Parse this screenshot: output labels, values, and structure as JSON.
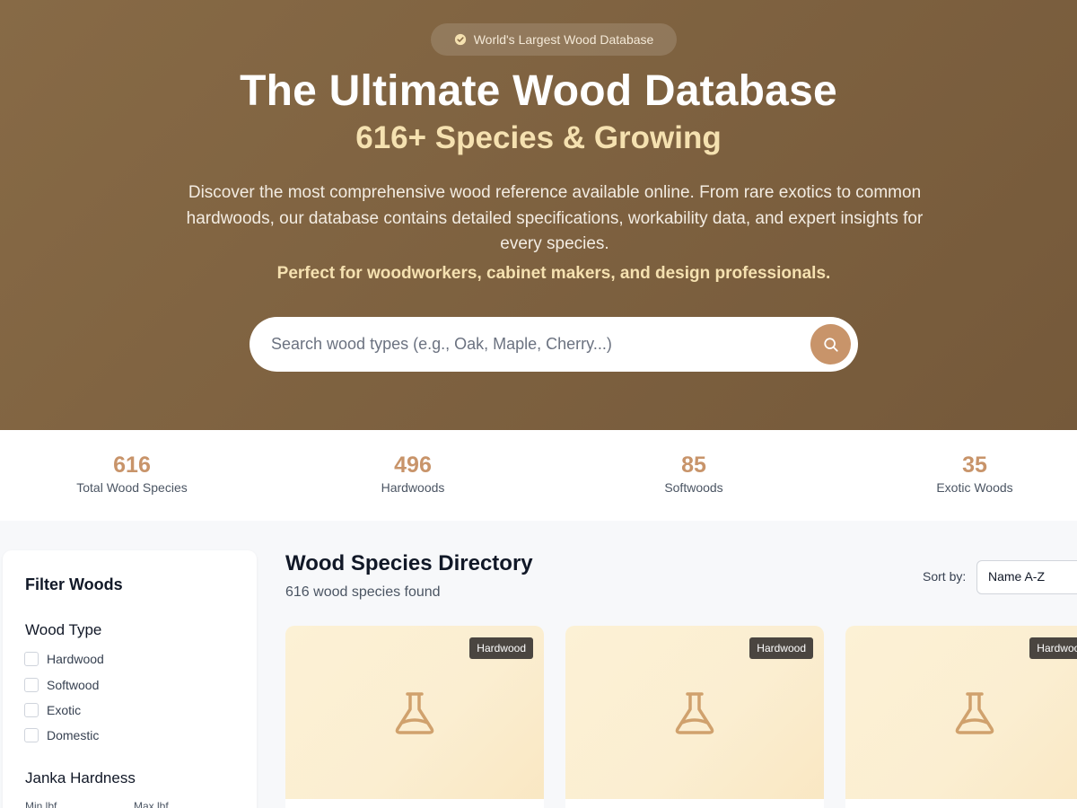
{
  "hero": {
    "badge": "World's Largest Wood Database",
    "title": "The Ultimate Wood Database",
    "subtitle": "616+ Species & Growing",
    "description": "Discover the most comprehensive wood reference available online. From rare exotics to common hardwoods, our database contains detailed specifications, workability data, and expert insights for every species.",
    "tagline": "Perfect for woodworkers, cabinet makers, and design professionals.",
    "search_placeholder": "Search wood types (e.g., Oak, Maple, Cherry...)"
  },
  "stats": [
    {
      "value": "616",
      "label": "Total Wood Species"
    },
    {
      "value": "496",
      "label": "Hardwoods"
    },
    {
      "value": "85",
      "label": "Softwoods"
    },
    {
      "value": "35",
      "label": "Exotic Woods"
    }
  ],
  "sidebar": {
    "title": "Filter Woods",
    "wood_type_title": "Wood Type",
    "wood_types": [
      "Hardwood",
      "Softwood",
      "Exotic",
      "Domestic"
    ],
    "janka_title": "Janka Hardness",
    "min_label": "Min lbf",
    "max_label": "Max lbf"
  },
  "directory": {
    "title": "Wood Species Directory",
    "count": "616 wood species found",
    "sort_label": "Sort by:",
    "sort_value": "Name A-Z"
  },
  "cards": [
    {
      "badge": "Hardwood",
      "icon": "flask-icon"
    },
    {
      "badge": "Hardwood",
      "icon": "flask-icon"
    },
    {
      "badge": "Hardwood",
      "icon": "flask-icon"
    }
  ],
  "colors": {
    "hero_bg": "#7e6141",
    "accent": "#c8946a",
    "subtitle": "#f5e1b0",
    "badge_bg": "#4a4540"
  }
}
